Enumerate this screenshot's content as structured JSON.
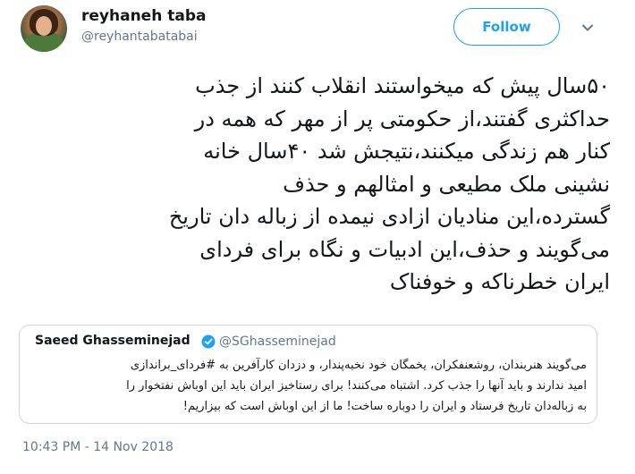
{
  "author": {
    "name": "reyhaneh taba",
    "handle": "@reyhantabatabai"
  },
  "follow_label": "Follow",
  "tweet_lines": [
    "۵۰سال پیش که میخواستند انقلاب کنند از جذب",
    "حداکثری گفتند،از حکومتی پر از مهر که همه در",
    "کنار هم زندگی میکنند،نتیجش شد ۴۰سال خانه",
    "نشینی ملک مطیعی و امثالهم و حذف",
    "گسترده،این منادیان ازادی نیمده از زباله دان تاریخ",
    "می‌گویند و حذف،این ادبیات و نگاه برای فردای",
    "ایران خطرناکه و خوفناک"
  ],
  "quoted": {
    "name": "Saeed Ghasseminejad",
    "handle": "@SGhasseminejad",
    "lines": [
      "می‌گویند هنربندان، روشعنفکران، یخمگان خود نخبه‌پندار، و دزدان کارآفرین به #فردای_براندازی",
      "امید ندارند و باید آنها را جذب کرد. اشتباه می‌کنند! برای رستاخیز ایران باید این اوباش نفتخوار را",
      "به زباله‌دان تاریخ فرستاد و ایران را دوباره ساخت! ما از این اوباش است که بیزاریم!"
    ]
  },
  "timestamp": "10:43 PM - 14 Nov 2018",
  "icons": {
    "caret": "chevron-down-icon",
    "verified": "verified-badge-icon"
  },
  "colors": {
    "accent": "#1da1f2",
    "secondary_text": "#657786",
    "border": "#ccd6dd"
  }
}
